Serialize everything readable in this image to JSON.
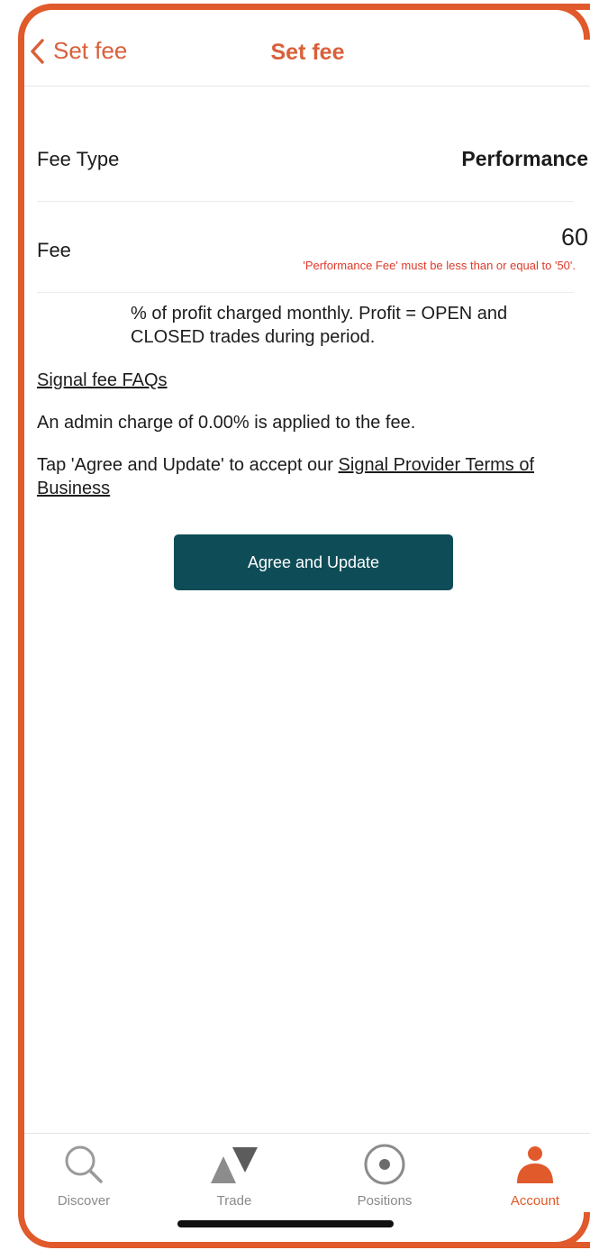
{
  "header": {
    "back_label": "Set fee",
    "title": "Set fee"
  },
  "fee_type": {
    "label": "Fee Type",
    "value": "Performance"
  },
  "fee": {
    "label": "Fee",
    "value": "60",
    "error": "'Performance Fee' must be less than or equal to '50'."
  },
  "description": "% of profit charged monthly. Profit = OPEN and CLOSED trades during period.",
  "faq_link": "Signal fee FAQs",
  "admin_text": "An admin charge of 0.00% is applied to the fee.",
  "terms": {
    "prefix": "Tap 'Agree and Update' to accept our ",
    "link": "Signal Provider Terms of Business"
  },
  "agree_button": "Agree and Update",
  "tabs": [
    {
      "label": "Discover",
      "icon": "search-icon",
      "active": false
    },
    {
      "label": "Trade",
      "icon": "trade-arrows-icon",
      "active": false
    },
    {
      "label": "Positions",
      "icon": "positions-icon",
      "active": false
    },
    {
      "label": "Account",
      "icon": "account-icon",
      "active": true
    }
  ],
  "colors": {
    "accent": "#e05a2b",
    "button": "#0e4d57",
    "error": "#e0392b",
    "inactive_tab": "#8a8a8a"
  }
}
